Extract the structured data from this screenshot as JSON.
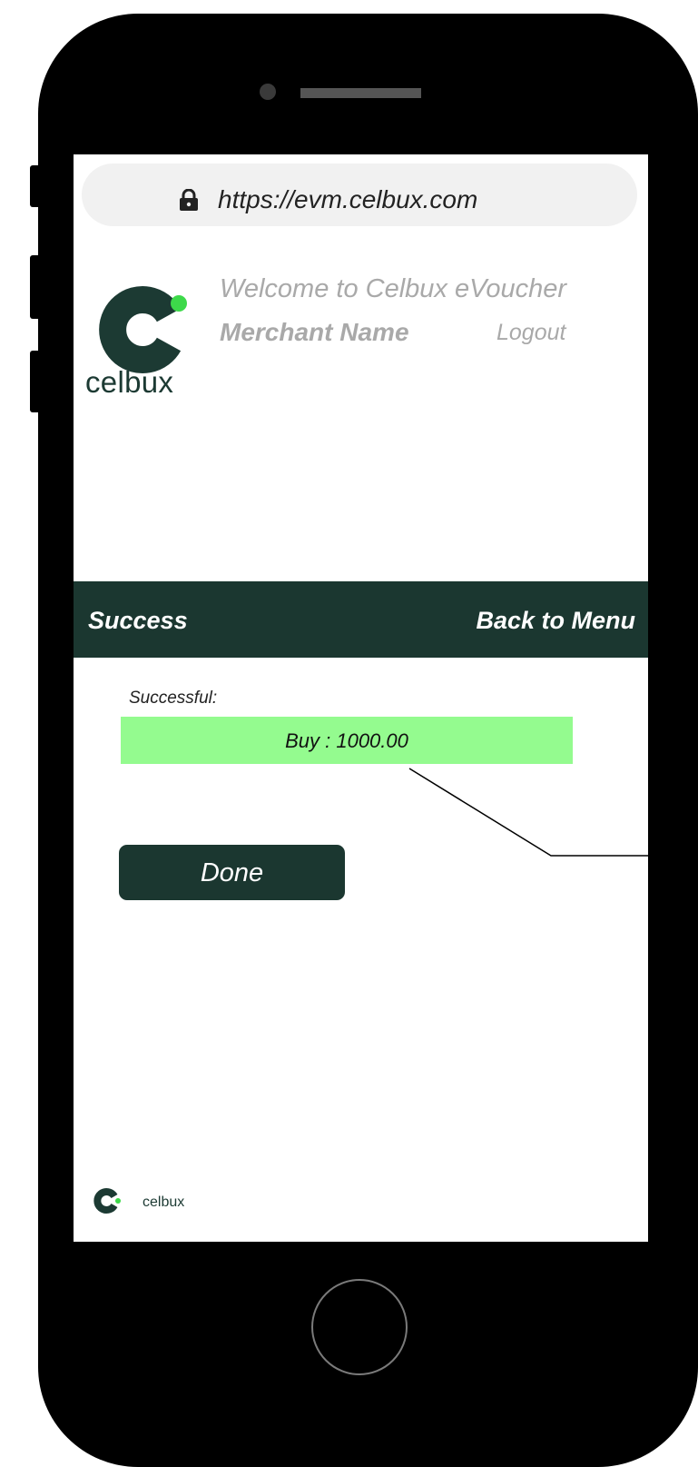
{
  "browser": {
    "url": "https://evm.celbux.com"
  },
  "brand": {
    "name": "celbux",
    "primary_color": "#1b3730",
    "accent_color": "#3dd94a"
  },
  "header": {
    "welcome_text": "Welcome to Celbux eVoucher",
    "merchant_name": "Merchant Name",
    "logout_label": "Logout"
  },
  "title_bar": {
    "title": "Success",
    "back_label": "Back to Menu"
  },
  "result": {
    "label": "Successful:",
    "value": "Buy : 1000.00",
    "highlight_color": "#94fb8f"
  },
  "actions": {
    "done_label": "Done"
  },
  "footer": {
    "brand_name": "celbux"
  },
  "icons": {
    "lock": "lock-icon",
    "logo": "celbux-logo-icon"
  }
}
